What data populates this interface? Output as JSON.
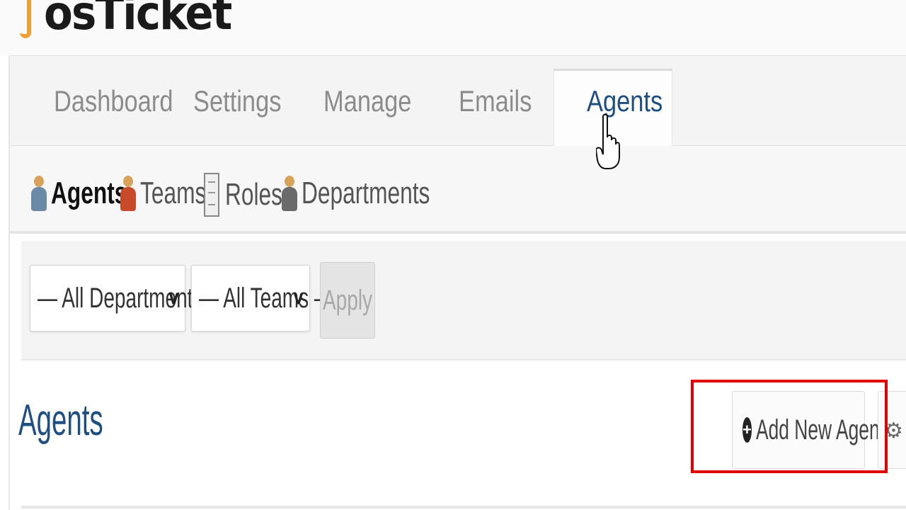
{
  "app": {
    "logo_text": "osTicket"
  },
  "nav": {
    "tabs": [
      {
        "label": "Dashboard"
      },
      {
        "label": "Settings"
      },
      {
        "label": "Manage"
      },
      {
        "label": "Emails"
      },
      {
        "label": "Agents",
        "active": true
      }
    ]
  },
  "subnav": {
    "items": [
      {
        "label": "Agents",
        "icon": "agent-icon",
        "active": true
      },
      {
        "label": "Teams",
        "icon": "teams-icon"
      },
      {
        "label": "Roles",
        "icon": "roles-icon"
      },
      {
        "label": "Departments",
        "icon": "departments-icon"
      }
    ]
  },
  "filters": {
    "department_select": "— All Departments —",
    "team_select": "— All Teams —",
    "apply_label": "Apply"
  },
  "page": {
    "title": "Agents",
    "add_button_label": "Add New Agent"
  },
  "colors": {
    "active_tab_text": "#1f4f80",
    "highlight_box": "#e00000",
    "logo_accent": "#f0a030"
  }
}
